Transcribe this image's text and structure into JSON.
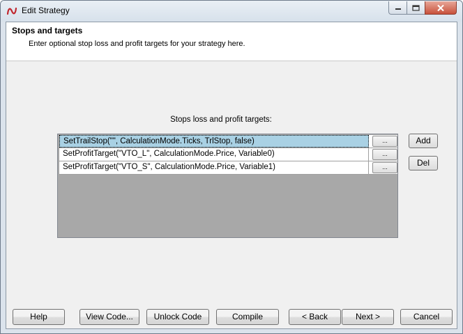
{
  "window": {
    "title": "Edit Strategy",
    "controls": {
      "minimize": "minimize-icon",
      "maximize": "maximize-icon",
      "close": "close-icon"
    }
  },
  "header": {
    "title": "Stops and targets",
    "description": "Enter optional stop loss and profit targets for your strategy here."
  },
  "list": {
    "label": "Stops loss and profit targets:",
    "rows": [
      {
        "text": "SetTrailStop(\"\", CalculationMode.Ticks, TrlStop, false)",
        "button": "...",
        "selected": true
      },
      {
        "text": "SetProfitTarget(\"VTO_L\", CalculationMode.Price, Variable0)",
        "button": "..."
      },
      {
        "text": "SetProfitTarget(\"VTO_S\", CalculationMode.Price, Variable1)",
        "button": "..."
      }
    ],
    "add_label": "Add",
    "del_label": "Del"
  },
  "footer": {
    "help": "Help",
    "view_code": "View Code...",
    "unlock_code": "Unlock Code",
    "compile": "Compile",
    "back": "< Back",
    "next": "Next >",
    "cancel": "Cancel"
  },
  "colors": {
    "selection": "#a9d1e4",
    "grid_background": "#a8a8a8",
    "close_button": "#c8513b"
  }
}
